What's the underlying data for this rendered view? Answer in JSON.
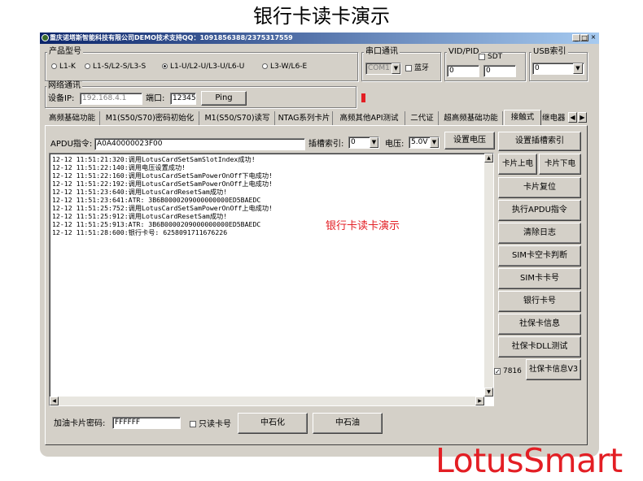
{
  "page_title": "银行卡读卡演示",
  "window": {
    "title": "重庆诺塔斯智能科技有限公司DEMO技术支持QQ：1091856388/2375317559",
    "controls": [
      "_",
      "□",
      "×"
    ]
  },
  "product_model": {
    "label": "产品型号",
    "options": [
      "L1-K",
      "L1-S/L2-S/L3-S",
      "L1-U/L2-U/L3-U/L6-U",
      "L3-W/L6-E"
    ],
    "selected_index": 2
  },
  "serial": {
    "label": "串口通讯",
    "port_value": "COM1",
    "bluetooth_label": "蓝牙"
  },
  "vidpid": {
    "label": "VID/PID",
    "sdt_label": "SDT",
    "vid_value": "0",
    "pid_value": "0"
  },
  "usb": {
    "label": "USB索引",
    "value": "0"
  },
  "network": {
    "label": "网络通讯",
    "ip_label": "设备IP:",
    "ip_value": "192.168.4.1",
    "port_label": "端口:",
    "port_value": "12345",
    "ping_label": "Ping"
  },
  "tabs": [
    "高频基础功能",
    "M1(S50/S70)密码初始化",
    "M1(S50/S70)读写",
    "NTAG系列卡片",
    "高频其他API测试",
    "二代证",
    "超高频基础功能",
    "接触式",
    "继电器"
  ],
  "active_tab_index": 7,
  "apdu": {
    "label": "APDU指令:",
    "value": "A0A40000023F00",
    "slot_label": "插槽索引:",
    "slot_value": "0",
    "voltage_label": "电压:",
    "voltage_value": "5.0V",
    "set_voltage_button": "设置电压"
  },
  "log_lines": [
    "12-12 11:51:21:320:调用LotusCardSetSamSlotIndex成功!",
    "12-12 11:51:22:140:调用电压设置成功!",
    "12-12 11:51:22:160:调用LotusCardSetSamPowerOnOff下电成功!",
    "12-12 11:51:22:192:调用LotusCardSetSamPowerOnOff上电成功!",
    "12-12 11:51:23:640:调用LotusCardResetSam成功!",
    "12-12 11:51:23:641:ATR: 3B6B0000209000000000ED5BAEDC",
    "12-12 11:51:25:752:调用LotusCardSetSamPowerOnOff上电成功!",
    "12-12 11:51:25:912:调用LotusCardResetSam成功!",
    "12-12 11:51:25:913:ATR: 3B6B0000209000000000ED5BAEDC",
    "12-12 11:51:28:600:银行卡号: 6258091711676226"
  ],
  "overlay_text": "银行卡读卡演示",
  "side_buttons": {
    "set_slot": "设置插槽索引",
    "card_power_on": "卡片上电",
    "card_power_off": "卡片下电",
    "card_reset": "卡片复位",
    "exec_apdu": "执行APDU指令",
    "clear_log": "清除日志",
    "sim_empty": "SIM卡空卡判断",
    "sim_number": "SIM卡卡号",
    "bank_number": "银行卡号",
    "social_info": "社保卡信息",
    "social_dll": "社保卡DLL测试",
    "social_v3": "社保卡信息V3",
    "check_7816": "7816"
  },
  "bottom": {
    "fuel_pwd_label": "加油卡片密码:",
    "fuel_pwd_value": "FFFFFF",
    "readonly_label": "只读卡号",
    "sinopec_button": "中石化",
    "petrochina_button": "中石油"
  },
  "brand_text": "LotusSmart",
  "colors": {
    "title_bar_start": "#0a246a",
    "title_bar_end": "#a6caf0",
    "window_face": "#d4d0c8",
    "brand_red": "#e31e24",
    "status_red": "#e31e24"
  }
}
